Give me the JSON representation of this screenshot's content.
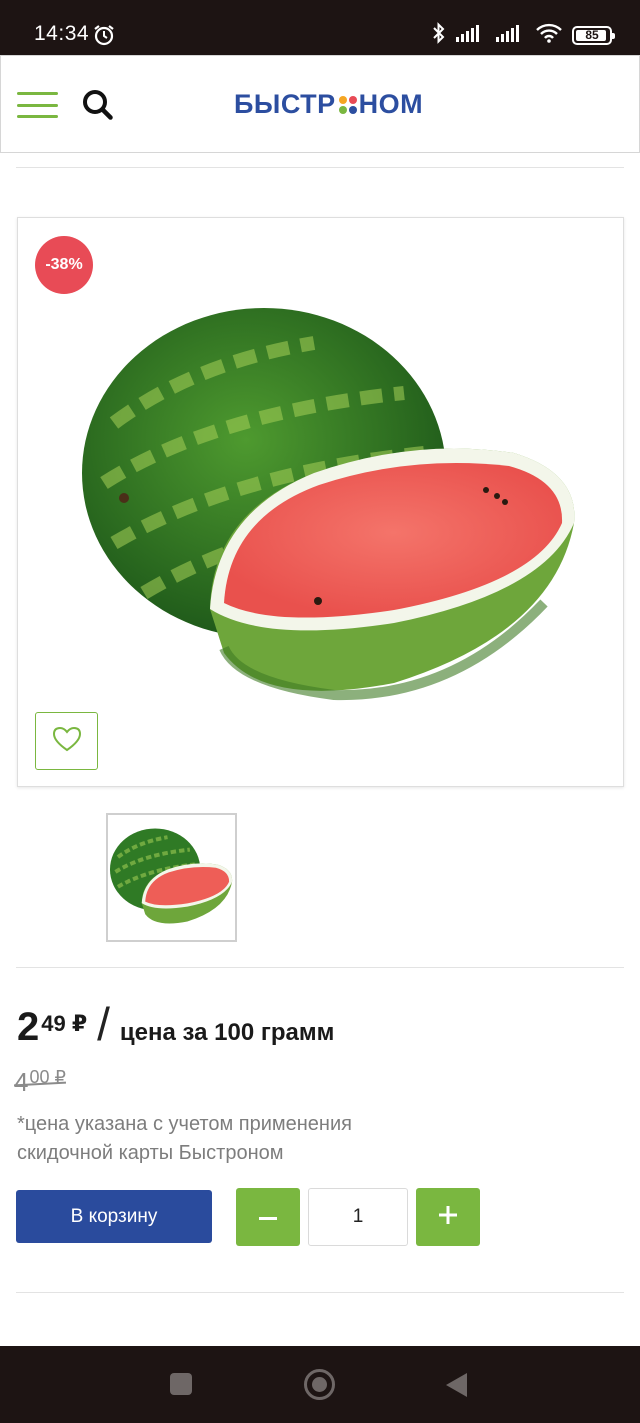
{
  "status_bar": {
    "time": "14:34",
    "battery": "85"
  },
  "header": {
    "logo_left": "БЫСТР",
    "logo_right": "НОМ",
    "logo_dot_colors": [
      "#f5a623",
      "#e84b56",
      "#7ab740",
      "#2c4ea0"
    ]
  },
  "product": {
    "discount_badge": "-38%",
    "price_int": "2",
    "price_dec": "49 ₽",
    "price_slash": "/",
    "price_unit": "цена за 100 грамм",
    "old_price_int": "4",
    "old_price_dec": "00 ₽",
    "note": "*цена указана с учетом применения скидочной карты Быстроном"
  },
  "cart": {
    "add_label": "В корзину",
    "quantity": "1"
  },
  "colors": {
    "accent_green": "#7ab740",
    "brand_blue": "#2a4b9d",
    "badge_red": "#e84b56"
  }
}
